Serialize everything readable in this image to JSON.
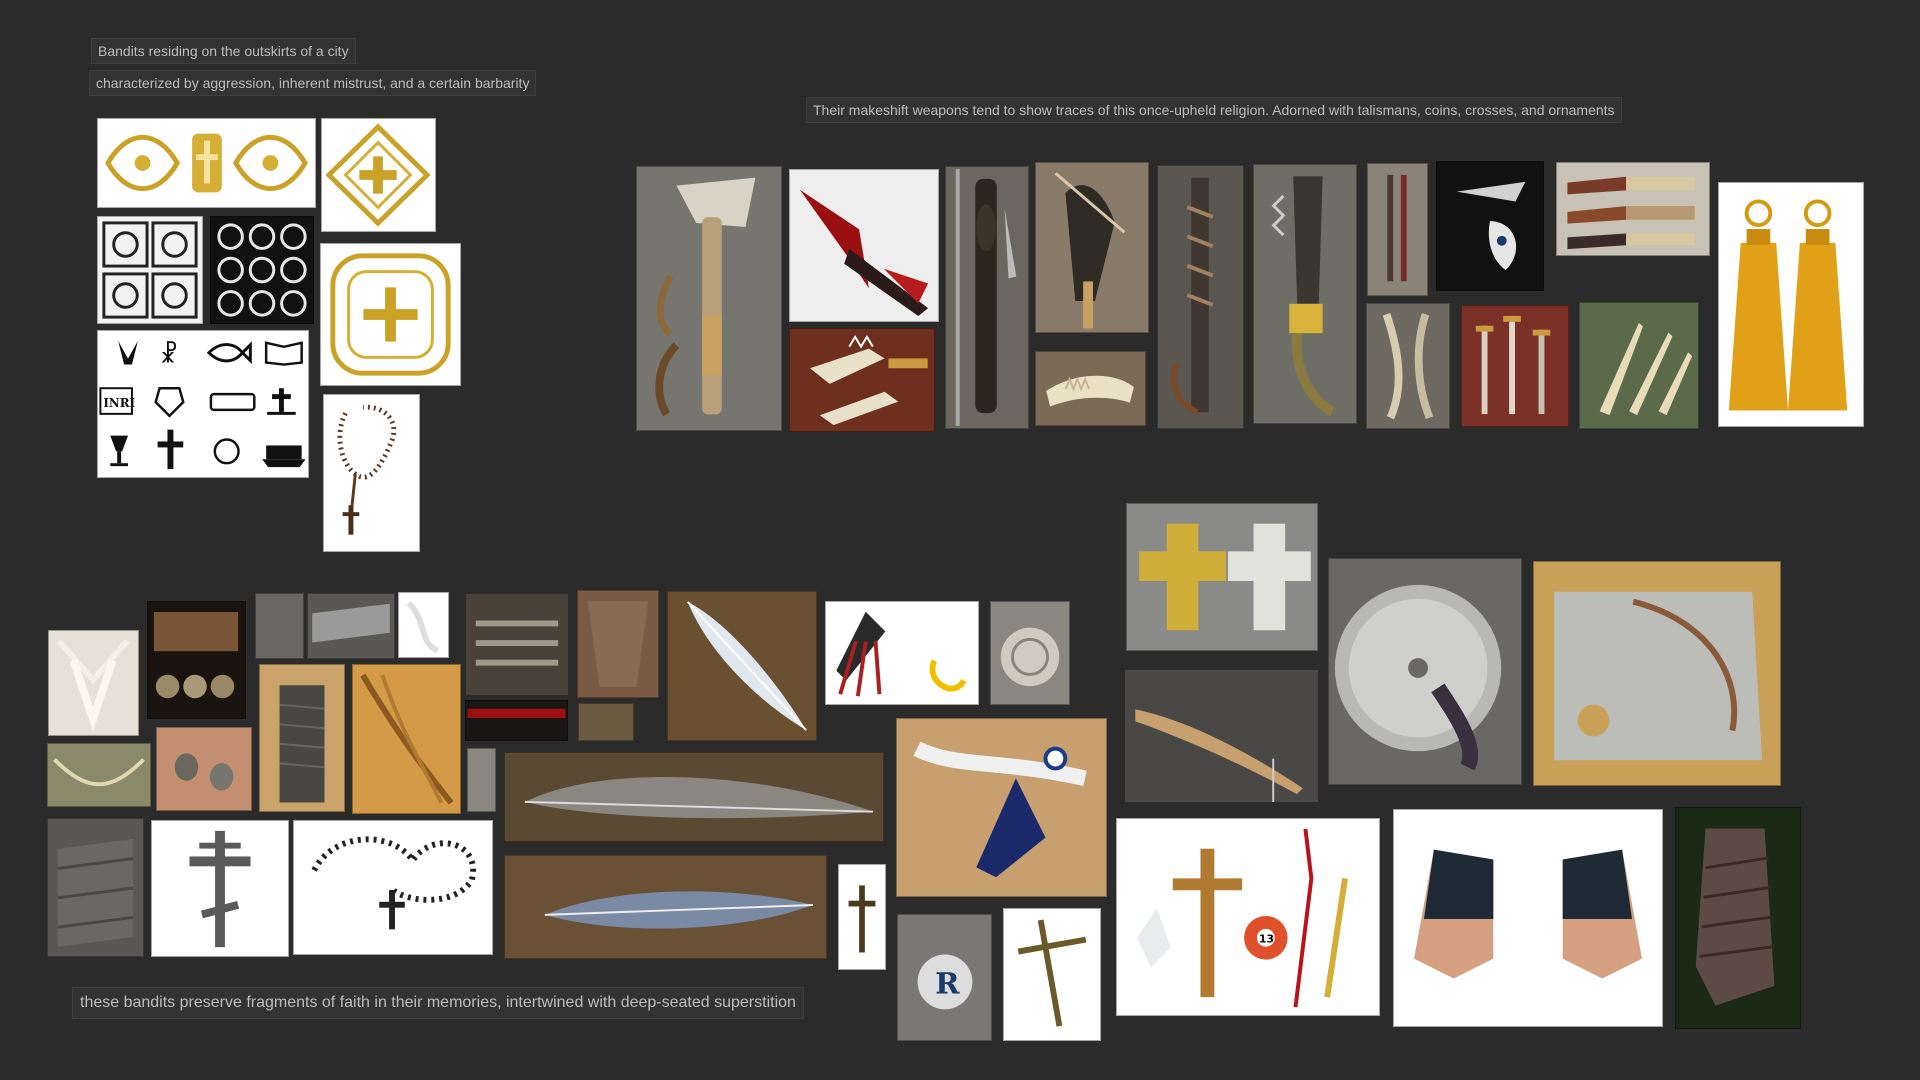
{
  "board": {
    "background": "#2b2b2b",
    "notes": {
      "note1": "Bandits residing on the outskirts of a city",
      "note2": "characterized by aggression, inherent mistrust, and a certain barbarity",
      "note3": "Their makeshift weapons tend to show traces of this once-upheld religion. Adorned with talismans, coins, crosses, and ornaments",
      "note4": "these bandits preserve fragments of faith in their memories, intertwined with deep-seated superstition"
    },
    "icons": {
      "inri_label": "INRI",
      "pendant_letter": "R",
      "ball_number": "13"
    }
  }
}
